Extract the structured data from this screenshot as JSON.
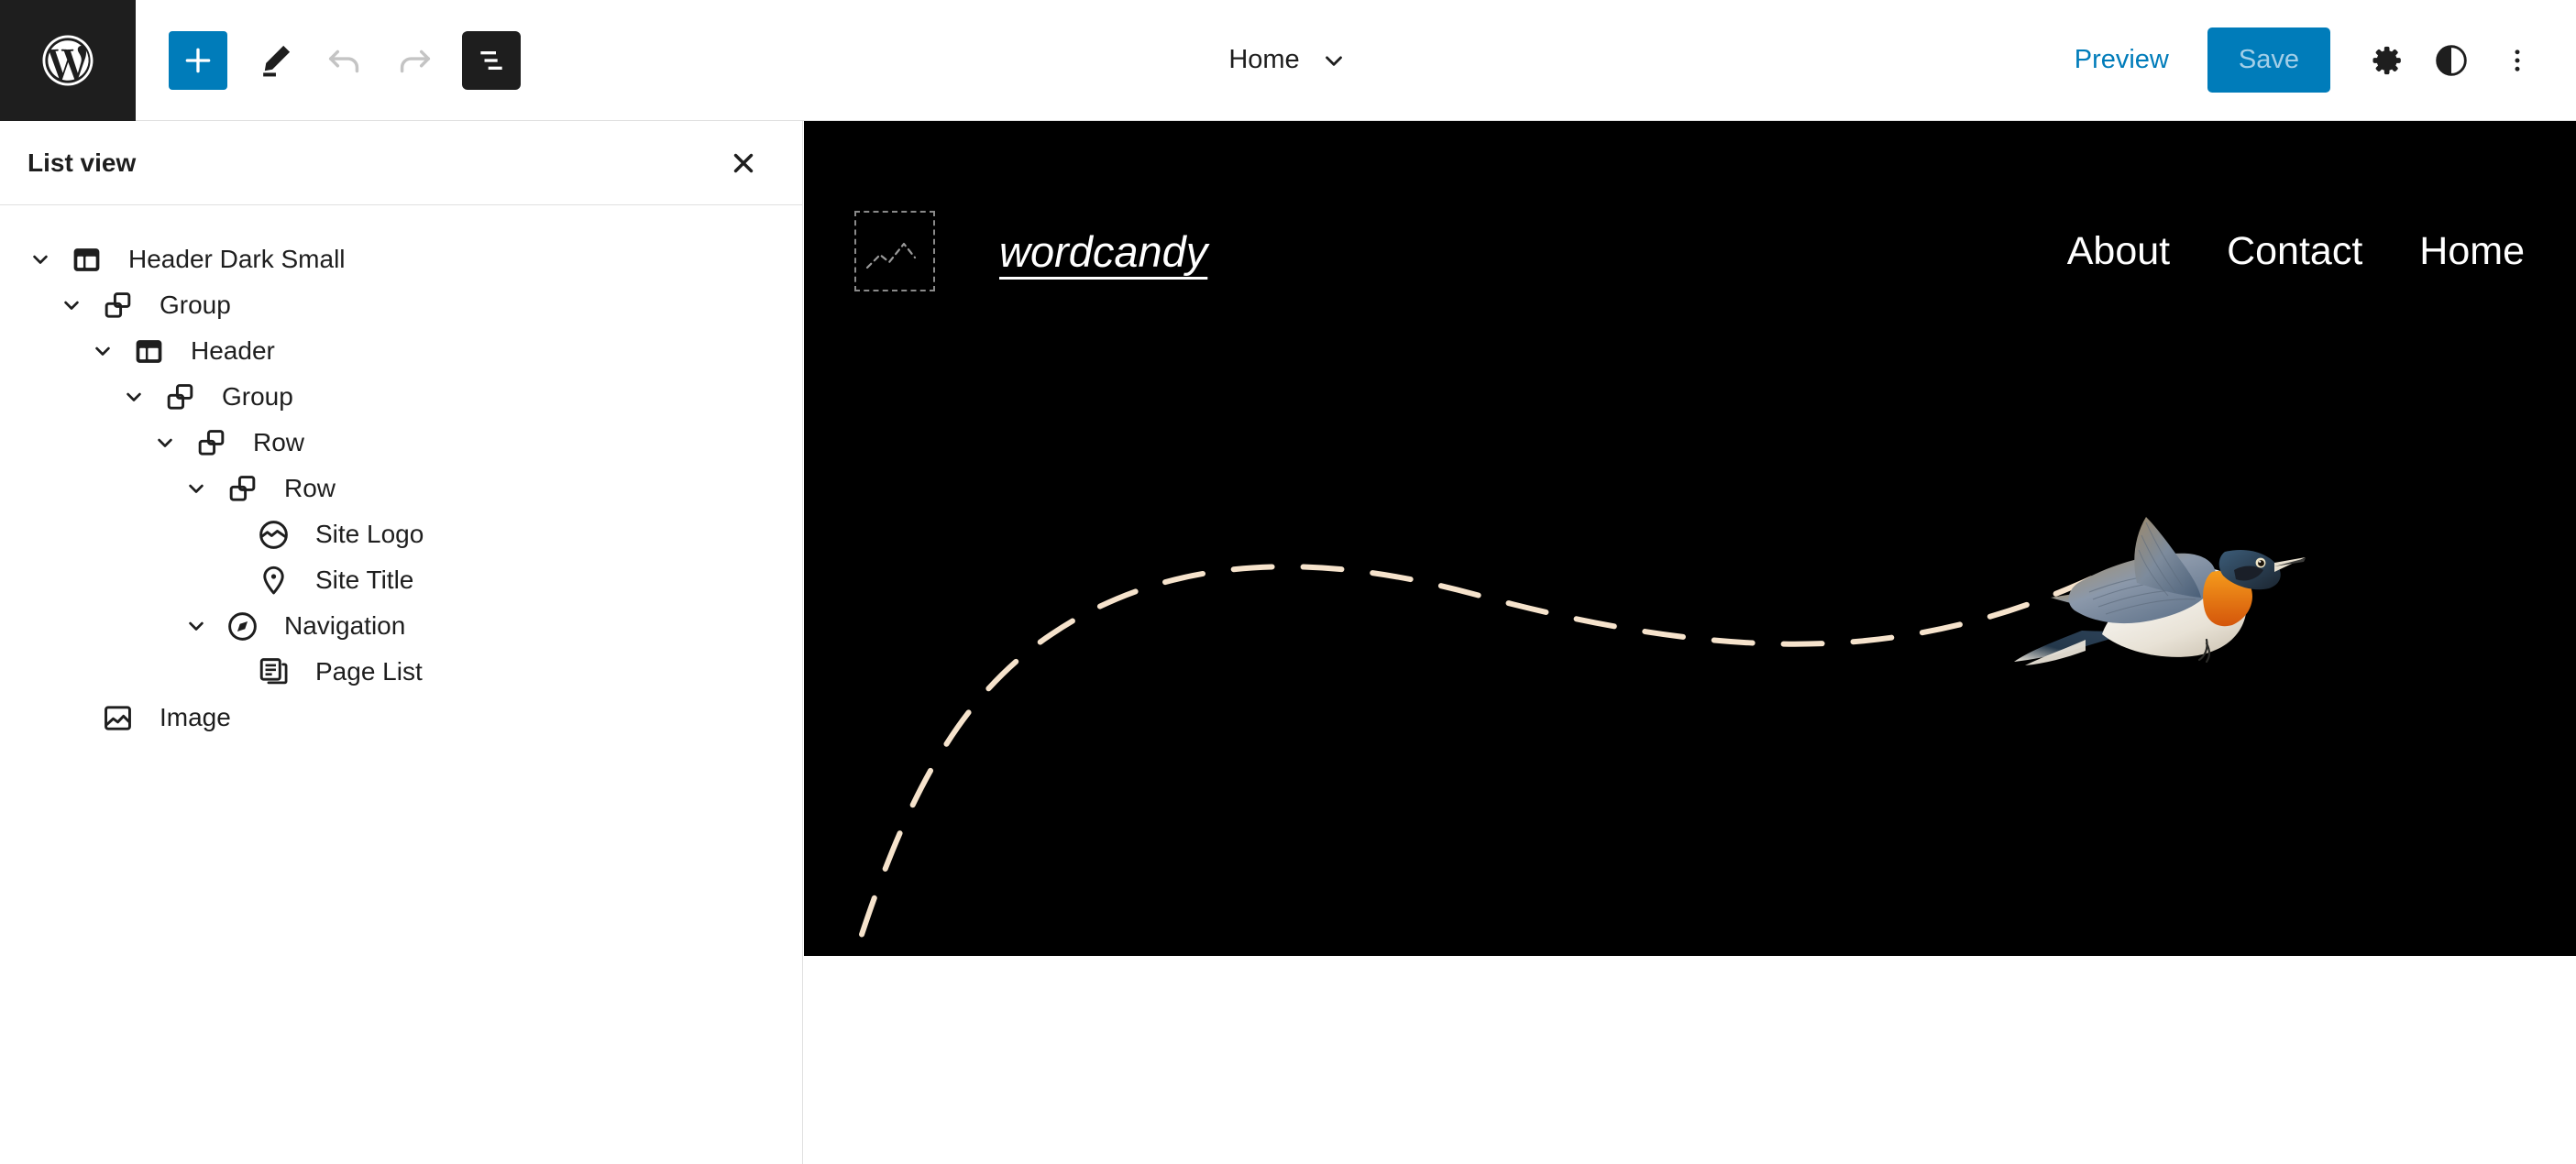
{
  "toolbar": {
    "wp_logo_icon": "wordpress-logo-icon",
    "tools": [
      {
        "name": "block-inserter-button",
        "icon": "plus-icon",
        "label": "Toggle block inserter",
        "state": "primary"
      },
      {
        "name": "edit-mode-button",
        "icon": "pencil-icon",
        "label": "Edit",
        "state": "default"
      },
      {
        "name": "undo-button",
        "icon": "undo-arrow-icon",
        "label": "Undo",
        "state": "disabled"
      },
      {
        "name": "redo-button",
        "icon": "redo-arrow-icon",
        "label": "Redo",
        "state": "disabled"
      },
      {
        "name": "list-view-button",
        "icon": "list-view-icon",
        "label": "List View",
        "state": "active"
      }
    ],
    "document_title": "Home",
    "document_title_chevron": "chevron-down-icon",
    "preview_label": "Preview",
    "save_label": "Save",
    "save_disabled": true,
    "settings_icon": "gear-icon",
    "styles_icon": "contrast-half-circle-icon",
    "options_icon": "kebab-vertical-dots-icon"
  },
  "sidebar": {
    "title": "List view",
    "close_icon": "close-x-icon",
    "tree": [
      {
        "label": "Header Dark Small",
        "icon": "template-part-icon",
        "depth": 0,
        "expanded": true,
        "has_children": true
      },
      {
        "label": "Group",
        "icon": "group-icon",
        "depth": 1,
        "expanded": true,
        "has_children": true
      },
      {
        "label": "Header",
        "icon": "template-part-icon",
        "depth": 2,
        "expanded": true,
        "has_children": true
      },
      {
        "label": "Group",
        "icon": "group-icon",
        "depth": 3,
        "expanded": true,
        "has_children": true
      },
      {
        "label": "Row",
        "icon": "group-icon",
        "depth": 4,
        "expanded": true,
        "has_children": true
      },
      {
        "label": "Row",
        "icon": "group-icon",
        "depth": 5,
        "expanded": true,
        "has_children": true
      },
      {
        "label": "Site Logo",
        "icon": "site-logo-icon",
        "depth": 6,
        "expanded": false,
        "has_children": false
      },
      {
        "label": "Site Title",
        "icon": "map-pin-icon",
        "depth": 6,
        "expanded": false,
        "has_children": false
      },
      {
        "label": "Navigation",
        "icon": "compass-icon",
        "depth": 5,
        "expanded": true,
        "has_children": true
      },
      {
        "label": "Page List",
        "icon": "page-list-icon",
        "depth": 6,
        "expanded": false,
        "has_children": false
      },
      {
        "label": "Image",
        "icon": "image-icon",
        "depth": 1,
        "expanded": false,
        "has_children": false
      }
    ]
  },
  "canvas": {
    "header_background": "#000000",
    "site_logo_placeholder_icon": "site-logo-placeholder-icon",
    "site_title": "wordcandy",
    "nav_items": [
      {
        "label": "About"
      },
      {
        "label": "Contact"
      },
      {
        "label": "Home"
      }
    ],
    "decoration": {
      "flight_path_color": "#f6e3cc",
      "flight_path_name": "dashed-flight-path",
      "bird_image_name": "flying-bird-illustration"
    }
  },
  "colors": {
    "accent_blue": "#007cba",
    "toolbar_dark": "#1e1e1e",
    "save_text": "#a3cfe8",
    "cream": "#f6e3cc"
  }
}
